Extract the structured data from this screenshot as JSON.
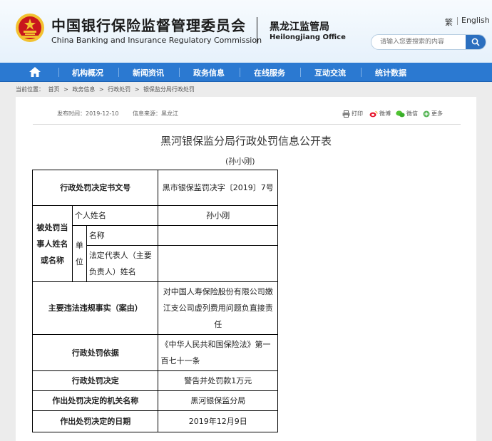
{
  "header": {
    "org_cn": "中国银行保险监督管理委员会",
    "org_en": "China Banking and Insurance Regulatory Commission",
    "office_cn": "黑龙江监管局",
    "office_en": "Heilongjiang Office",
    "lang_traditional": "繁",
    "lang_english": "English",
    "search_placeholder": "请输入您要搜索的内容"
  },
  "nav": {
    "items": [
      {
        "label": "机构概况"
      },
      {
        "label": "新闻资讯"
      },
      {
        "label": "政务信息"
      },
      {
        "label": "在线服务"
      },
      {
        "label": "互动交流"
      },
      {
        "label": "统计数据"
      }
    ]
  },
  "breadcrumb": {
    "prefix": "当前位置：",
    "items": [
      "首页",
      "政务信息",
      "行政处罚",
      "银保监分局行政处罚"
    ],
    "separator": ">"
  },
  "meta": {
    "publish_time": "发布时间：2019-12-10",
    "source": "信息来源：黑龙江"
  },
  "share": {
    "print": "打印",
    "weibo": "微博",
    "wechat": "微信",
    "more": "更多"
  },
  "article": {
    "title": "黑河银保监分局行政处罚信息公开表",
    "subtitle": "(孙小刚)"
  },
  "table": {
    "doc_no_label": "行政处罚决定书文号",
    "doc_no_value": "黑市银保监罚决字〔2019〕7号",
    "party_label": "被处罚当事人姓名或名称",
    "person_label": "个人姓名",
    "person_value": "孙小刚",
    "unit_label": "单位",
    "unit_name_label": "名称",
    "unit_name_value": "",
    "legal_rep_label": "法定代表人（主要负责人）姓名",
    "legal_rep_value": "",
    "violation_label": "主要违法违规事实（案由）",
    "violation_value": "对中国人寿保险股份有限公司嫩江支公司虚列费用问题负直接责任",
    "basis_label": "行政处罚依据",
    "basis_value": "《中华人民共和国保险法》第一百七十一条",
    "decision_label": "行政处罚决定",
    "decision_value": "警告并处罚款1万元",
    "authority_label": "作出处罚决定的机关名称",
    "authority_value": "黑河银保监分局",
    "date_label": "作出处罚决定的日期",
    "date_value": "2019年12月9日"
  },
  "colors": {
    "nav_bg": "#2b79d1",
    "search_button": "#2b6fbf",
    "emblem_red": "#c8161d",
    "emblem_gold": "#f2c230"
  }
}
